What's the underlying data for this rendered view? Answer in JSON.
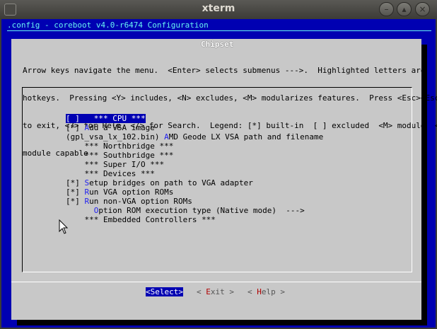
{
  "window": {
    "title": "xterm",
    "minimize_glyph": "–",
    "maximize_glyph": "▴",
    "close_glyph": "×"
  },
  "config_line": ".config - coreboot v4.0-r6474 Configuration",
  "dialog": {
    "title": "Chipset",
    "help_lines": [
      "Arrow keys navigate the menu.  <Enter> selects submenus --->.  Highlighted letters are",
      "hotkeys.  Pressing <Y> includes, <N> excludes, <M> modularizes features.  Press <Esc><Esc>",
      "to exit, <?> for Help, </> for Search.  Legend: [*] built-in  [ ] excluded  <M> module  < >",
      "module capable"
    ]
  },
  "menu": [
    {
      "prefix": "[ ] ",
      "hot": "",
      "rest": "  *** CPU ***",
      "selected": true
    },
    {
      "prefix": "[*] ",
      "hot": "A",
      "rest": "dd a VSA image",
      "selected": false
    },
    {
      "prefix": "(gpl_vsa_lx_102.bin) ",
      "hot": "A",
      "rest": "MD Geode LX VSA path and filename",
      "selected": false
    },
    {
      "prefix": "    ",
      "hot": "",
      "rest": "*** Northbridge ***",
      "selected": false
    },
    {
      "prefix": "    ",
      "hot": "",
      "rest": "*** Southbridge ***",
      "selected": false
    },
    {
      "prefix": "    ",
      "hot": "",
      "rest": "*** Super I/O ***",
      "selected": false
    },
    {
      "prefix": "    ",
      "hot": "",
      "rest": "*** Devices ***",
      "selected": false
    },
    {
      "prefix": "[*] ",
      "hot": "S",
      "rest": "etup bridges on path to VGA adapter",
      "selected": false
    },
    {
      "prefix": "[*] ",
      "hot": "R",
      "rest": "un VGA option ROMs",
      "selected": false
    },
    {
      "prefix": "[*] ",
      "hot": "R",
      "rest": "un non-VGA option ROMs",
      "selected": false
    },
    {
      "prefix": "      ",
      "hot": "O",
      "rest": "ption ROM execution type (Native mode)  --->",
      "selected": false
    },
    {
      "prefix": "    ",
      "hot": "",
      "rest": "*** Embedded Controllers ***",
      "selected": false
    }
  ],
  "buttons": {
    "select": "<Select>",
    "exit_open": "< ",
    "exit_hot": "E",
    "exit_rest": "xit >",
    "help_open": "< ",
    "help_hot": "H",
    "help_rest": "elp >"
  },
  "colors": {
    "terminal_bg": "#0000b2",
    "dialog_bg": "#c8c8c8",
    "hotkey": "#2222ee",
    "config_text": "#67f2f2"
  }
}
